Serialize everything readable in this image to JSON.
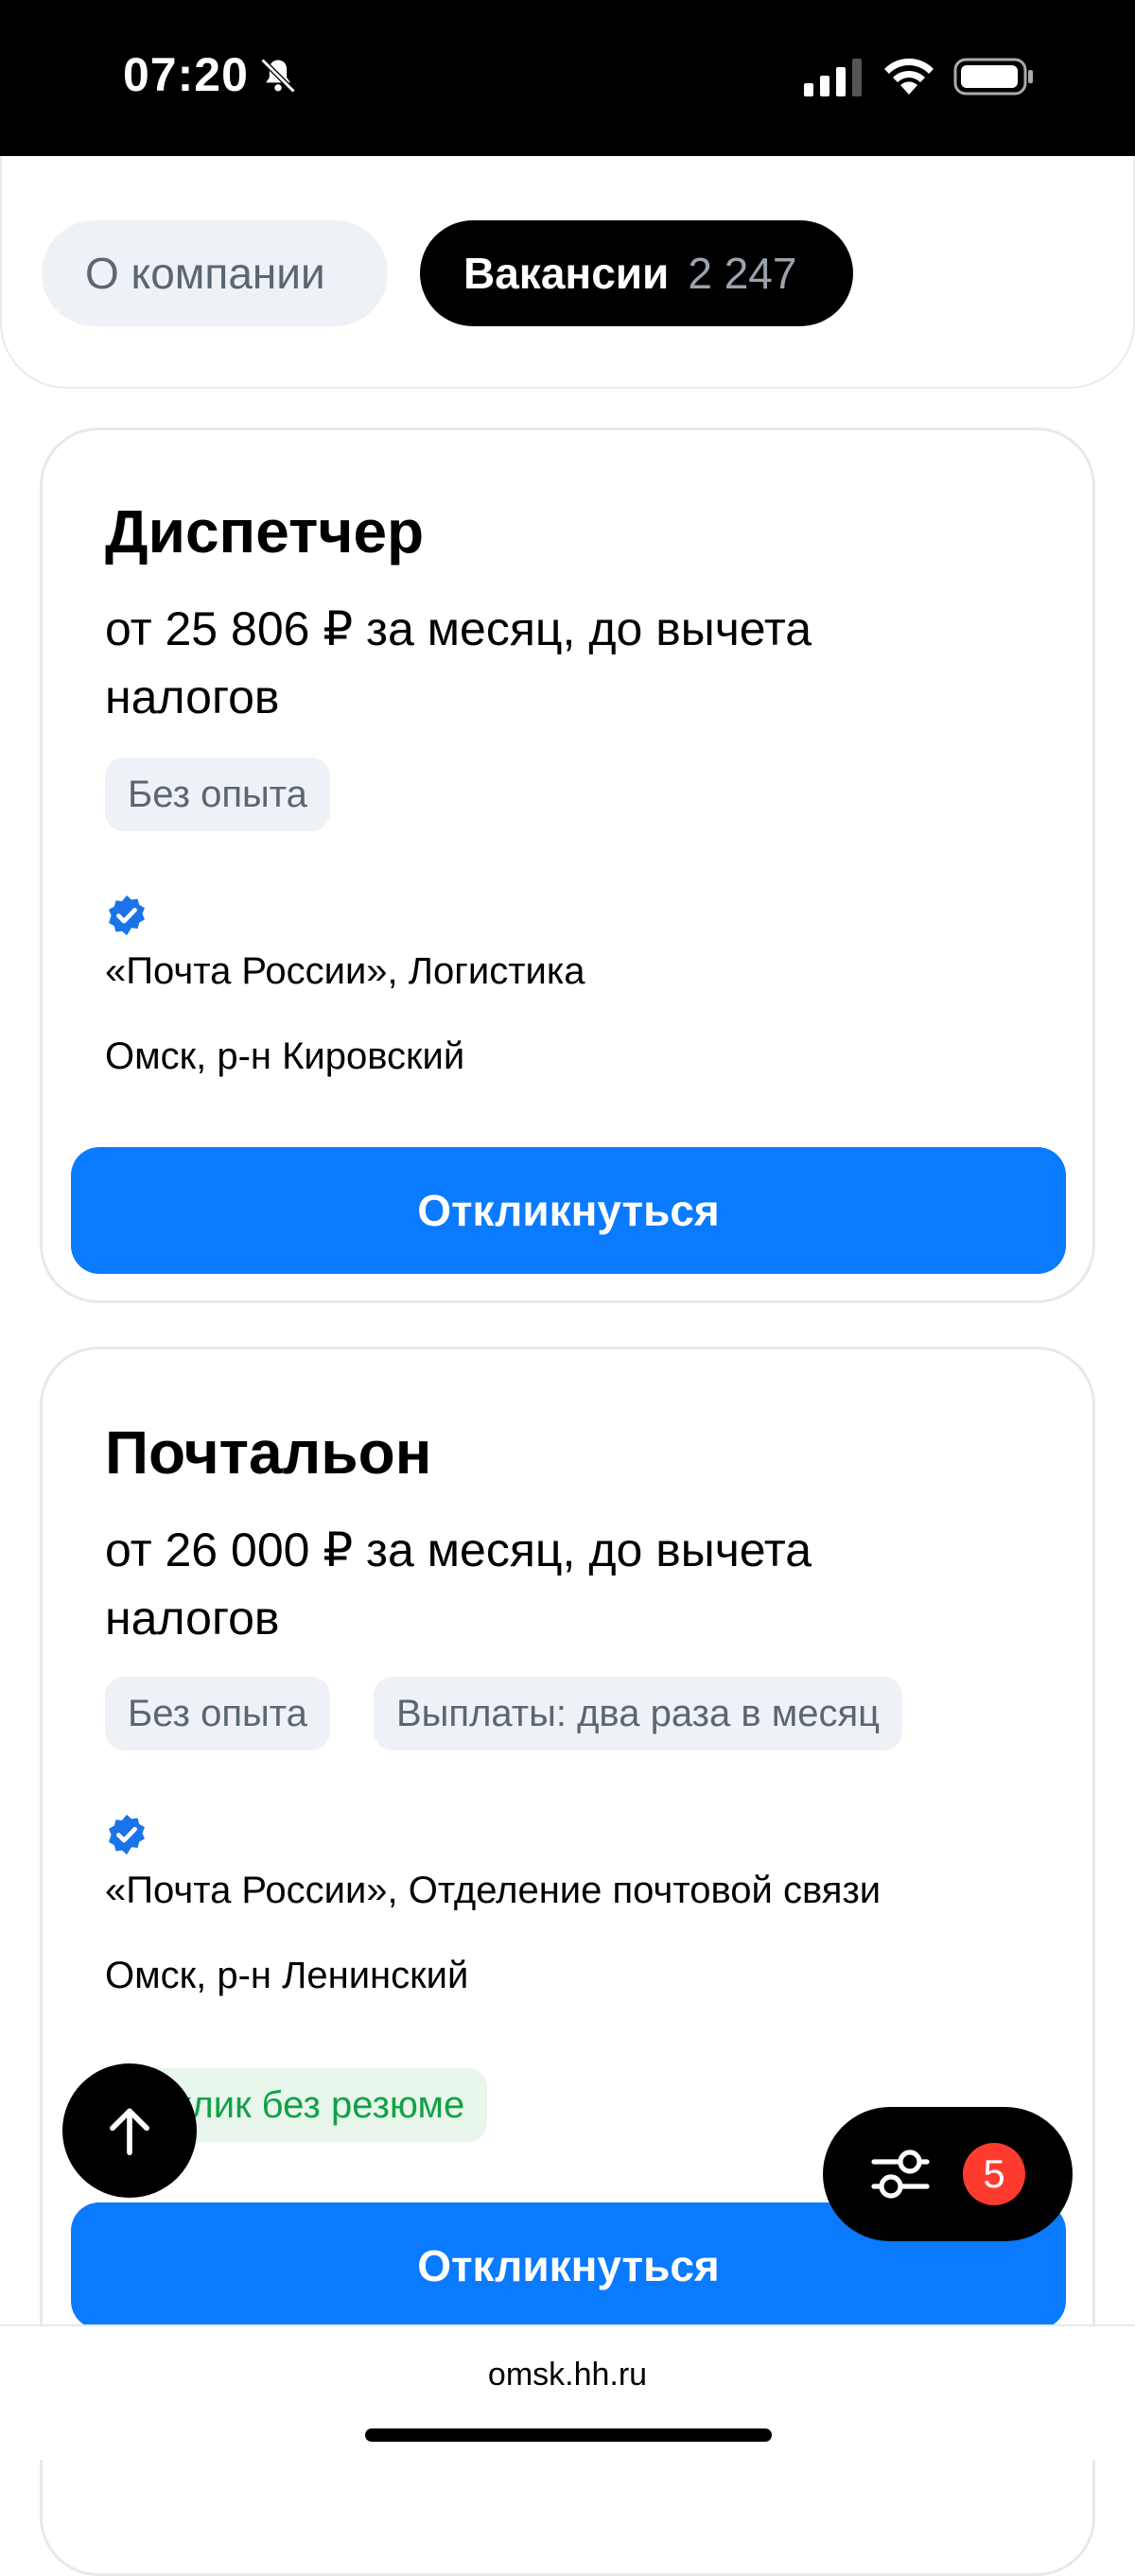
{
  "status_bar": {
    "time": "07:20"
  },
  "tabs": {
    "about_label": "О компании",
    "vacancies_label": "Вакансии",
    "vacancies_count": "2 247"
  },
  "vacancies": [
    {
      "title": "Диспетчер",
      "salary": "от 25 806 ₽ за месяц, до вычета налогов",
      "tags": [
        "Без опыта"
      ],
      "company": "«Почта России», Логистика",
      "location": "Омск, р-н Кировский",
      "respond_label": "Откликнуться"
    },
    {
      "title": "Почтальон",
      "salary": "от 26 000 ₽ за месяц, до вычета налогов",
      "tags": [
        "Без опыта",
        "Выплаты: два раза в месяц"
      ],
      "company": "«Почта России», Отделение почтовой связи",
      "location": "Омск, р-н Ленинский",
      "highlight_tag": "Отклик без резюме",
      "respond_label": "Откликнуться"
    }
  ],
  "floating": {
    "filter_count": "5"
  },
  "browser": {
    "domain": "omsk.hh.ru"
  },
  "colors": {
    "accent": "#0a7aff",
    "badge": "#ff3b30",
    "green": "#12a146",
    "verified": "#1a73e8"
  },
  "icons": [
    "bell-muted-icon",
    "signal-icon",
    "wifi-icon",
    "battery-icon",
    "verified-icon",
    "arrow-up-icon",
    "filter-sliders-icon"
  ]
}
